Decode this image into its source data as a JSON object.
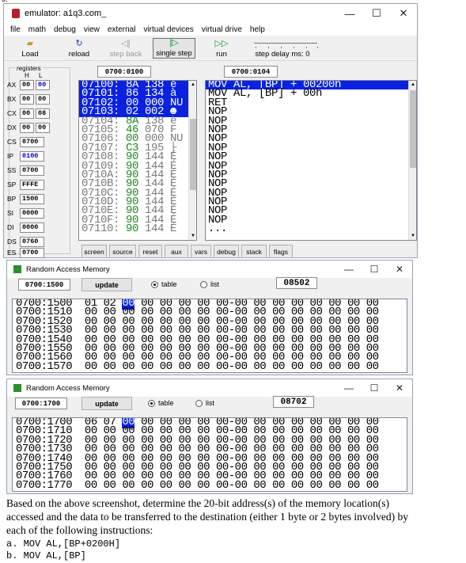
{
  "top_fragment": "ɔ.",
  "emulator": {
    "title": "emulator: a1q3.com_",
    "window_controls": [
      "—",
      "☐",
      "✕"
    ],
    "menu": [
      "file",
      "math",
      "debug",
      "view",
      "external",
      "virtual devices",
      "virtual drive",
      "help"
    ],
    "toolbar": {
      "load": "Load",
      "reload": "reload",
      "step_back": "step back",
      "single_step": "single step",
      "run": "run",
      "step_delay": "step delay ms: 0"
    },
    "registers_label": "registers",
    "col_h": "H",
    "col_l": "L",
    "registers": [
      {
        "name": "AX",
        "h": "00",
        "l": "00"
      },
      {
        "name": "BX",
        "h": "00",
        "l": "00"
      },
      {
        "name": "CX",
        "h": "00",
        "l": "08"
      },
      {
        "name": "DX",
        "h": "00",
        "l": "00"
      },
      {
        "name": "CS",
        "value": "0700"
      },
      {
        "name": "IP",
        "value": "0100"
      },
      {
        "name": "SS",
        "value": "0700"
      },
      {
        "name": "SP",
        "value": "FFFE"
      },
      {
        "name": "BP",
        "value": "1500"
      },
      {
        "name": "SI",
        "value": "0000"
      },
      {
        "name": "DI",
        "value": "0000"
      },
      {
        "name": "DS",
        "value": "0760"
      },
      {
        "name": "ES",
        "value": "0700"
      }
    ],
    "code_address": "0700:0100",
    "disasm_address": "0700:0104",
    "code_lines": [
      {
        "addr": "07100:",
        "hex": "8A",
        "dec": "138",
        "ch": "è",
        "sel": true
      },
      {
        "addr": "07101:",
        "hex": "86",
        "dec": "134",
        "ch": "à",
        "sel": true
      },
      {
        "addr": "07102:",
        "hex": "00",
        "dec": "000",
        "ch": "NU",
        "sel": true
      },
      {
        "addr": "07103:",
        "hex": "02",
        "dec": "002",
        "ch": "☻",
        "sel": true
      },
      {
        "addr": "07104:",
        "hex": "8A",
        "dec": "138",
        "ch": "è",
        "sel": false
      },
      {
        "addr": "07105:",
        "hex": "46",
        "dec": "070",
        "ch": "F",
        "sel": false
      },
      {
        "addr": "07106:",
        "hex": "00",
        "dec": "000",
        "ch": "NU",
        "sel": false
      },
      {
        "addr": "07107:",
        "hex": "C3",
        "dec": "195",
        "ch": "├",
        "sel": false
      },
      {
        "addr": "07108:",
        "hex": "90",
        "dec": "144",
        "ch": "É",
        "sel": false
      },
      {
        "addr": "07109:",
        "hex": "90",
        "dec": "144",
        "ch": "É",
        "sel": false
      },
      {
        "addr": "0710A:",
        "hex": "90",
        "dec": "144",
        "ch": "É",
        "sel": false
      },
      {
        "addr": "0710B:",
        "hex": "90",
        "dec": "144",
        "ch": "É",
        "sel": false
      },
      {
        "addr": "0710C:",
        "hex": "90",
        "dec": "144",
        "ch": "É",
        "sel": false
      },
      {
        "addr": "0710D:",
        "hex": "90",
        "dec": "144",
        "ch": "É",
        "sel": false
      },
      {
        "addr": "0710E:",
        "hex": "90",
        "dec": "144",
        "ch": "É",
        "sel": false
      },
      {
        "addr": "0710F:",
        "hex": "90",
        "dec": "144",
        "ch": "É",
        "sel": false
      },
      {
        "addr": "07110:",
        "hex": "90",
        "dec": "144",
        "ch": "É",
        "sel": false
      }
    ],
    "disasm_lines": [
      {
        "text": "MOV AL, [BP] + 00200h",
        "sel": true
      },
      {
        "text": "MOV AL, [BP] + 00h",
        "sel": false
      },
      {
        "text": "RET",
        "sel": false
      },
      {
        "text": "NOP",
        "sel": false
      },
      {
        "text": "NOP",
        "sel": false
      },
      {
        "text": "NOP",
        "sel": false
      },
      {
        "text": "NOP",
        "sel": false
      },
      {
        "text": "NOP",
        "sel": false
      },
      {
        "text": "NOP",
        "sel": false
      },
      {
        "text": "NOP",
        "sel": false
      },
      {
        "text": "NOP",
        "sel": false
      },
      {
        "text": "NOP",
        "sel": false
      },
      {
        "text": "NOP",
        "sel": false
      },
      {
        "text": "NOP",
        "sel": false
      },
      {
        "text": "NOP",
        "sel": false
      },
      {
        "text": "NOP",
        "sel": false
      },
      {
        "text": "...",
        "sel": false
      }
    ],
    "tabs": [
      "screen",
      "source",
      "reset",
      "aux",
      "vars",
      "debug",
      "stack",
      "flags"
    ]
  },
  "ram1": {
    "title": "Random Access Memory",
    "address": "0700:1500",
    "update": "update",
    "table": "table",
    "list": "list",
    "readout": "08502",
    "rows": [
      {
        "addr": "0700:1500",
        "b": [
          "01",
          "02",
          "00",
          "00",
          "00",
          "00",
          "00",
          "00",
          "00",
          "00",
          "00",
          "00",
          "00",
          "00",
          "00",
          "00"
        ]
      },
      {
        "addr": "0700:1510",
        "b": [
          "00",
          "00",
          "00",
          "00",
          "00",
          "00",
          "00",
          "00",
          "00",
          "00",
          "00",
          "00",
          "00",
          "00",
          "00",
          "00"
        ]
      },
      {
        "addr": "0700:1520",
        "b": [
          "00",
          "00",
          "00",
          "00",
          "00",
          "00",
          "00",
          "00",
          "00",
          "00",
          "00",
          "00",
          "00",
          "00",
          "00",
          "00"
        ]
      },
      {
        "addr": "0700:1530",
        "b": [
          "00",
          "00",
          "00",
          "00",
          "00",
          "00",
          "00",
          "00",
          "00",
          "00",
          "00",
          "00",
          "00",
          "00",
          "00",
          "00"
        ]
      },
      {
        "addr": "0700:1540",
        "b": [
          "00",
          "00",
          "00",
          "00",
          "00",
          "00",
          "00",
          "00",
          "00",
          "00",
          "00",
          "00",
          "00",
          "00",
          "00",
          "00"
        ]
      },
      {
        "addr": "0700:1550",
        "b": [
          "00",
          "00",
          "00",
          "00",
          "00",
          "00",
          "00",
          "00",
          "00",
          "00",
          "00",
          "00",
          "00",
          "00",
          "00",
          "00"
        ]
      },
      {
        "addr": "0700:1560",
        "b": [
          "00",
          "00",
          "00",
          "00",
          "00",
          "00",
          "00",
          "00",
          "00",
          "00",
          "00",
          "00",
          "00",
          "00",
          "00",
          "00"
        ]
      },
      {
        "addr": "0700:1570",
        "b": [
          "00",
          "00",
          "00",
          "00",
          "00",
          "00",
          "00",
          "00",
          "00",
          "00",
          "00",
          "00",
          "00",
          "00",
          "00",
          "00"
        ]
      }
    ],
    "highlight_col": 2
  },
  "ram2": {
    "title": "Random Access Memory",
    "address": "0700:1700",
    "update": "update",
    "table": "table",
    "list": "list",
    "readout": "08702",
    "rows": [
      {
        "addr": "0700:1700",
        "b": [
          "06",
          "07",
          "00",
          "00",
          "00",
          "00",
          "00",
          "00",
          "00",
          "00",
          "00",
          "00",
          "00",
          "00",
          "00",
          "00"
        ]
      },
      {
        "addr": "0700:1710",
        "b": [
          "00",
          "00",
          "00",
          "00",
          "00",
          "00",
          "00",
          "00",
          "00",
          "00",
          "00",
          "00",
          "00",
          "00",
          "00",
          "00"
        ]
      },
      {
        "addr": "0700:1720",
        "b": [
          "00",
          "00",
          "00",
          "00",
          "00",
          "00",
          "00",
          "00",
          "00",
          "00",
          "00",
          "00",
          "00",
          "00",
          "00",
          "00"
        ]
      },
      {
        "addr": "0700:1730",
        "b": [
          "00",
          "00",
          "00",
          "00",
          "00",
          "00",
          "00",
          "00",
          "00",
          "00",
          "00",
          "00",
          "00",
          "00",
          "00",
          "00"
        ]
      },
      {
        "addr": "0700:1740",
        "b": [
          "00",
          "00",
          "00",
          "00",
          "00",
          "00",
          "00",
          "00",
          "00",
          "00",
          "00",
          "00",
          "00",
          "00",
          "00",
          "00"
        ]
      },
      {
        "addr": "0700:1750",
        "b": [
          "00",
          "00",
          "00",
          "00",
          "00",
          "00",
          "00",
          "00",
          "00",
          "00",
          "00",
          "00",
          "00",
          "00",
          "00",
          "00"
        ]
      },
      {
        "addr": "0700:1760",
        "b": [
          "00",
          "00",
          "00",
          "00",
          "00",
          "00",
          "00",
          "00",
          "00",
          "00",
          "00",
          "00",
          "00",
          "00",
          "00",
          "00"
        ]
      },
      {
        "addr": "0700:1770",
        "b": [
          "00",
          "00",
          "00",
          "00",
          "00",
          "00",
          "00",
          "00",
          "00",
          "00",
          "00",
          "00",
          "00",
          "00",
          "00",
          "00"
        ]
      }
    ],
    "highlight_col": 2
  },
  "question": {
    "line1": "Based on the above screenshot, determine the 20-bit address(s) of the memory location(s)",
    "line2": "accessed and the data to be transferred to the destination (either 1 byte or 2 bytes involved) by",
    "line3": "each of the following instructions:",
    "a": "a. MOV AL,[BP+0200H]",
    "b": "b. MOV AL,[BP]"
  }
}
